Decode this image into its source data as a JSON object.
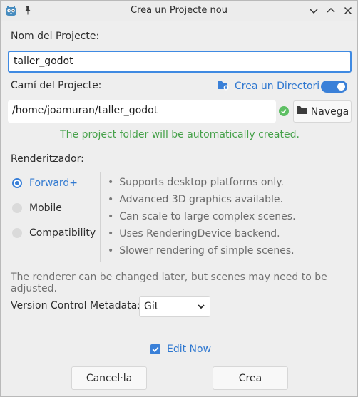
{
  "window": {
    "title": "Crea un Projecte nou"
  },
  "project": {
    "name_label": "Nom del Projecte:",
    "name_value": "taller_godot",
    "path_label": "Camí del Projecte:",
    "create_dir_label": "Crea un Directori",
    "create_dir_enabled": true,
    "path_value": "/home/joamuran/taller_godot",
    "browse_label": "Navega",
    "status_text": "The project folder will be automatically created."
  },
  "renderer": {
    "label": "Renderitzador:",
    "options": [
      {
        "label": "Forward+",
        "selected": true
      },
      {
        "label": "Mobile",
        "selected": false
      },
      {
        "label": "Compatibility",
        "selected": false
      }
    ],
    "features": [
      "Supports desktop platforms only.",
      "Advanced 3D graphics available.",
      "Can scale to large complex scenes.",
      "Uses RenderingDevice backend.",
      "Slower rendering of simple scenes."
    ],
    "note": "The renderer can be changed later, but scenes may need to be adjusted."
  },
  "version_control": {
    "label": "Version Control Metadata:",
    "selected": "Git"
  },
  "edit_now": {
    "label": "Edit Now",
    "checked": true
  },
  "buttons": {
    "cancel": "Cancel·la",
    "create": "Crea"
  },
  "colors": {
    "accent": "#3a80d8",
    "success": "#46a14a",
    "link": "#2f78d0"
  },
  "icons": {
    "app": "godot-icon",
    "pin": "pin-icon",
    "folder_add": "folder-add-icon",
    "valid": "check-circle-icon",
    "folder": "folder-icon",
    "dropdown": "chevron-down-icon"
  }
}
